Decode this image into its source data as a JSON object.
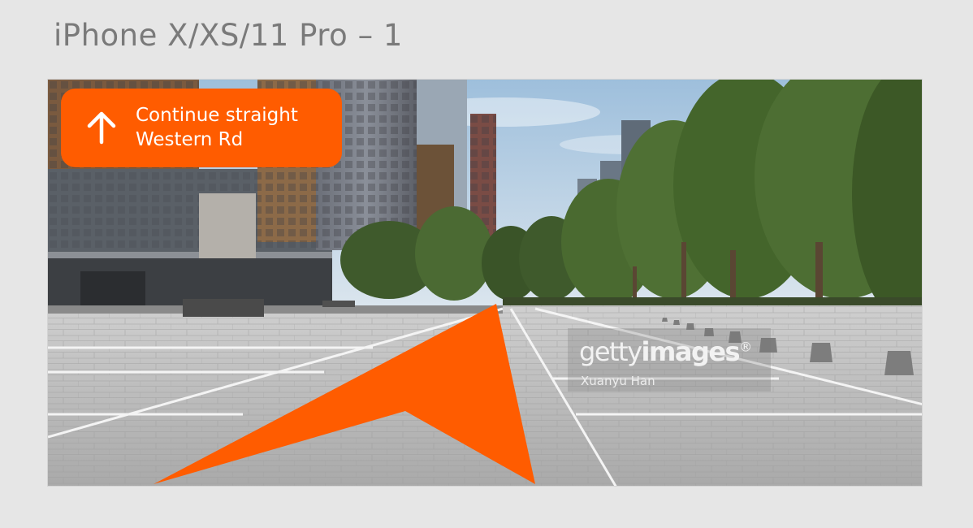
{
  "artboard": {
    "title": "iPhone X/XS/11 Pro – 1"
  },
  "navigation": {
    "instruction": "Continue straight",
    "street": "Western Rd",
    "icon": "arrow-up-icon",
    "accent_color": "#ff5c00"
  },
  "watermark": {
    "brand_regular": "getty",
    "brand_bold": "images",
    "registered": "®",
    "credit": "Xuanyu Han"
  }
}
